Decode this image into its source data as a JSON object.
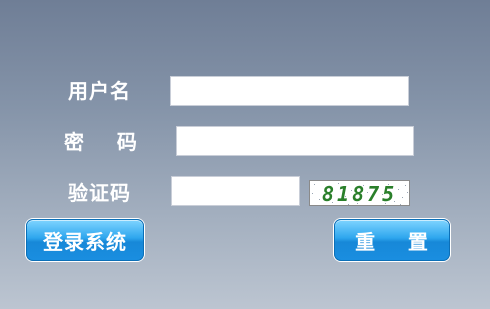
{
  "form": {
    "username_label": "用户名",
    "username_value": "",
    "password_label": "密    码",
    "password_value": "",
    "captcha_label": "验证码",
    "captcha_value": "",
    "captcha_text": "81875"
  },
  "buttons": {
    "login_label": "登录系统",
    "reset_label": "重    置"
  },
  "colors": {
    "background_top": "#6f7e96",
    "background_bottom": "#bcc5d1",
    "button_blue": "#1a8ee0",
    "captcha_green": "#2a7f2a"
  }
}
